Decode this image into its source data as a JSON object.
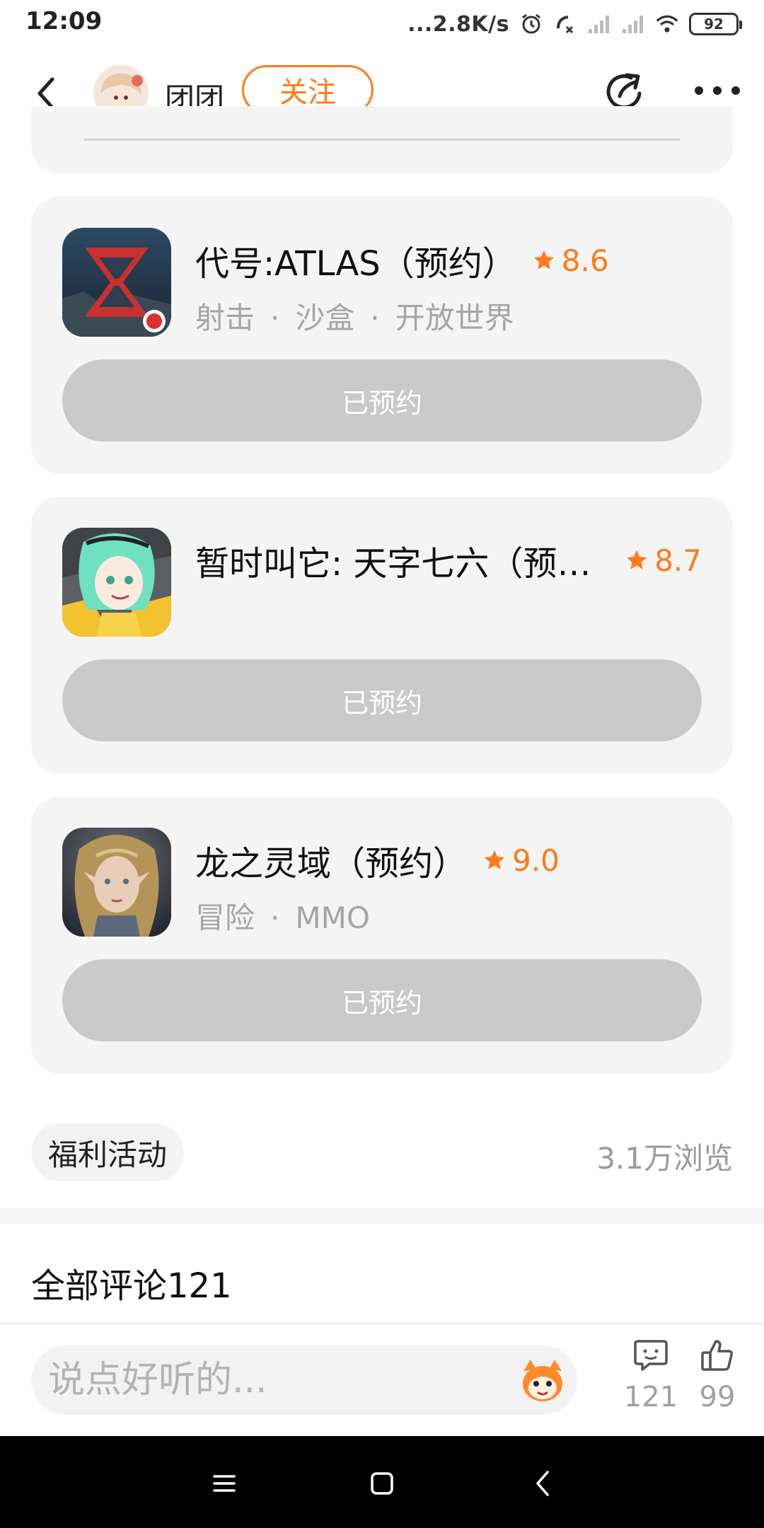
{
  "status_bar": {
    "time": "12:09",
    "net_speed": "...2.8K/s",
    "battery": "92"
  },
  "header": {
    "username": "团团",
    "follow_label": "关注"
  },
  "games": [
    {
      "title": "代号:ATLAS（预约）",
      "rating": "8.6",
      "tags": [
        "射击",
        "沙盒",
        "开放世界"
      ],
      "button_label": "已预约"
    },
    {
      "title": "暂时叫它: 天字七六（预约）",
      "rating": "8.7",
      "tags": [],
      "button_label": "已预约"
    },
    {
      "title": "龙之灵域（预约）",
      "rating": "9.0",
      "tags": [
        "冒险",
        "MMO"
      ],
      "button_label": "已预约"
    }
  ],
  "post_meta": {
    "tag": "福利活动",
    "views": "3.1万浏览"
  },
  "comments": {
    "title": "全部评论121",
    "input_placeholder": "说点好听的...",
    "comment_count": "121",
    "like_count": "99"
  },
  "colors": {
    "accent": "#ff7a1a",
    "card_bg": "#f4f4f4",
    "button_disabled": "#c9c9c9"
  }
}
